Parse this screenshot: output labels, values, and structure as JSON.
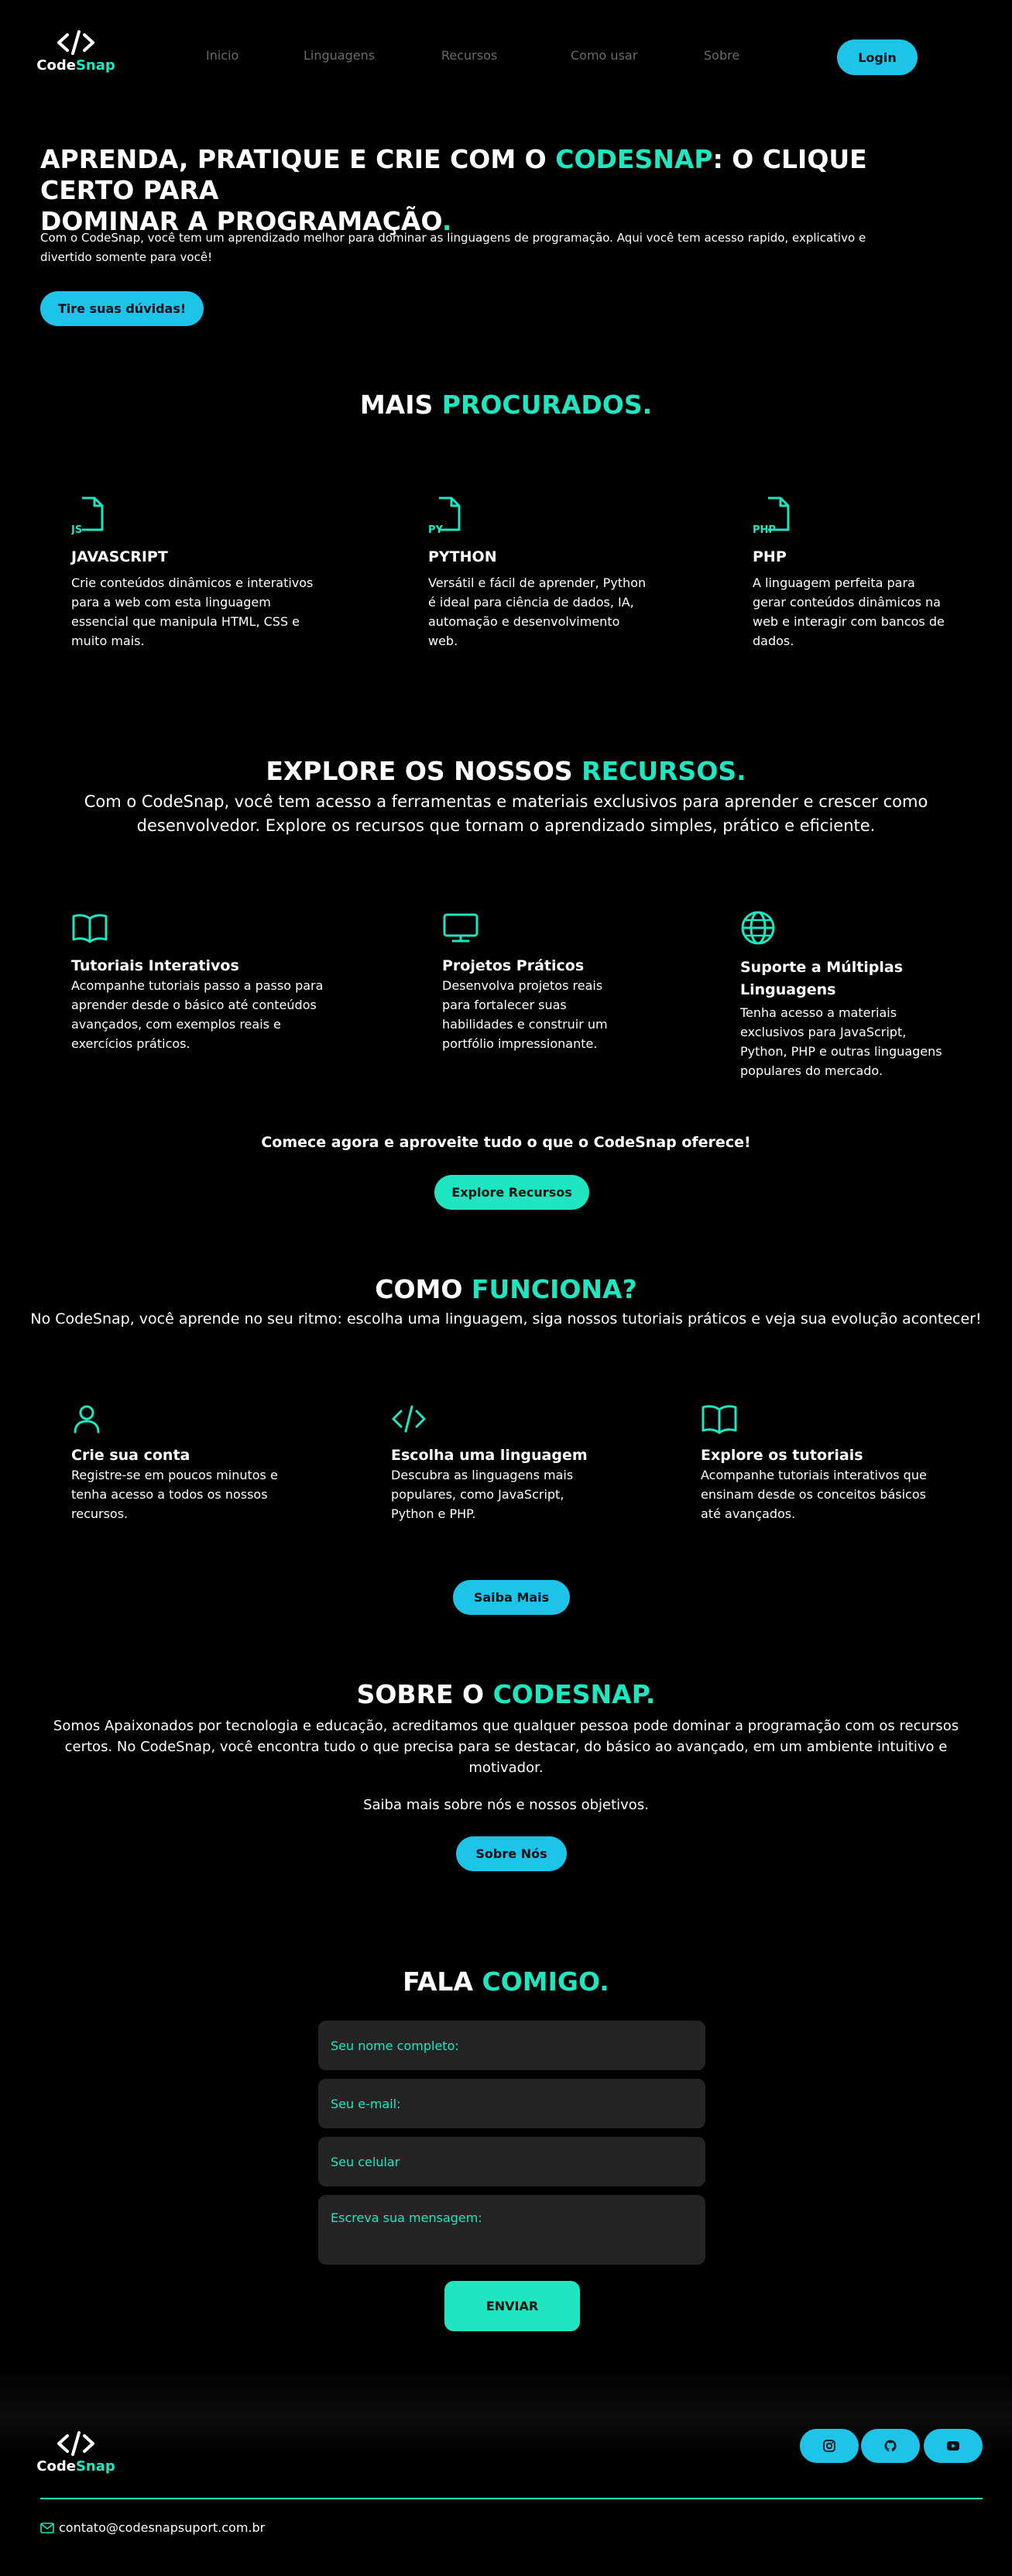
{
  "brand": {
    "logo_symbol": "</>",
    "name_part1": "Code",
    "name_part2": "Snap"
  },
  "nav": {
    "items": [
      "Inicio",
      "Linguagens",
      "Recursos",
      "Como usar",
      "Sobre"
    ],
    "login_label": "Login"
  },
  "hero": {
    "title_part1": "APRENDA, PRATIQUE E CRIE COM O ",
    "title_highlight": "CODESNAP",
    "title_part2": ": O CLIQUE CERTO PARA",
    "title_line2": "DOMINAR A PROGRAMAÇÃO",
    "title_dot": ".",
    "desc_line1": "Com o CodeSnap, você tem um aprendizado melhor para dominar as linguagens de programação. Aqui você tem acesso rapido, explicativo e",
    "desc_line2": "divertido somente para você!",
    "cta_label": "Tire suas dúvidas!"
  },
  "popular": {
    "title_part1": "MAIS ",
    "title_highlight": "PROCURADOS.",
    "cards": [
      {
        "badge": "JS",
        "title": "JAVASCRIPT",
        "lines": [
          "Crie conteúdos dinâmicos e interativos",
          "para a web com esta linguagem",
          "essencial que manipula HTML, CSS e",
          "muito mais."
        ]
      },
      {
        "badge": "PY",
        "title": "PYTHON",
        "lines": [
          "Versátil e fácil de aprender, Python",
          "é ideal para ciência de dados, IA,",
          "automação e desenvolvimento",
          "web."
        ]
      },
      {
        "badge": "PHP",
        "title": "PHP",
        "lines": [
          "A linguagem perfeita para",
          "gerar conteúdos dinâmicos na",
          "web e interagir com bancos de",
          "dados."
        ]
      }
    ]
  },
  "resources": {
    "title_part1": "EXPLORE OS NOSSOS ",
    "title_highlight": "RECURSOS.",
    "sub_line1": "Com o CodeSnap, você tem acesso a ferramentas e materiais exclusivos para aprender e crescer como",
    "sub_line2": "desenvolvedor. Explore os recursos que tornam o aprendizado simples, prático e eficiente.",
    "cards": [
      {
        "icon": "book-icon",
        "title_lines": [
          "Tutoriais Interativos"
        ],
        "lines": [
          "Acompanhe tutoriais passo a passo para",
          "aprender desde o básico até conteúdos",
          "avançados, com exemplos reais e",
          "exercícios práticos."
        ]
      },
      {
        "icon": "monitor-icon",
        "title_lines": [
          "Projetos Práticos"
        ],
        "lines": [
          "Desenvolva projetos reais",
          "para fortalecer suas",
          "habilidades e construir um",
          "portfólio impressionante."
        ]
      },
      {
        "icon": "globe-icon",
        "title_lines": [
          "Suporte a Múltiplas",
          "Linguagens"
        ],
        "lines": [
          "Tenha acesso a materiais",
          "exclusivos para JavaScript,",
          "Python, PHP e outras linguagens",
          "populares do mercado."
        ]
      }
    ],
    "cta_text": "Comece agora e aproveite tudo o que o CodeSnap oferece!",
    "cta_label": "Explore Recursos"
  },
  "how": {
    "title_part1": "COMO ",
    "title_highlight": "FUNCIONA?",
    "sub": "No CodeSnap, você aprende no seu ritmo: escolha uma linguagem, siga nossos tutoriais práticos e veja sua evolução acontecer!",
    "cards": [
      {
        "icon": "user-icon",
        "title": "Crie sua conta",
        "lines": [
          "Registre-se em poucos minutos e",
          "tenha acesso a todos os nossos",
          "recursos."
        ]
      },
      {
        "icon": "code-icon",
        "title": "Escolha uma linguagem",
        "lines": [
          "Descubra as linguagens mais",
          "populares, como JavaScript,",
          "Python e PHP."
        ]
      },
      {
        "icon": "book-icon",
        "title": "Explore os tutoriais",
        "lines": [
          "Acompanhe tutoriais interativos que",
          "ensinam desde os conceitos básicos",
          "até avançados."
        ]
      }
    ],
    "cta_label": "Saiba Mais"
  },
  "about": {
    "title_part1": "SOBRE O ",
    "title_highlight": "CODESNAP.",
    "lines": [
      "Somos Apaixonados por tecnologia e educação, acreditamos que qualquer pessoa pode dominar a programação com os recursos",
      "certos. No CodeSnap, você encontra tudo o que precisa para se destacar, do básico ao avançado, em um ambiente intuitivo e",
      "motivador."
    ],
    "more": "Saiba mais sobre nós e nossos objetivos.",
    "cta_label": "Sobre Nós"
  },
  "contact": {
    "title_part1": "FALA ",
    "title_highlight": "COMIGO.",
    "name_placeholder": "Seu nome completo:",
    "email_placeholder": "Seu e-mail:",
    "phone_placeholder": "Seu celular",
    "message_placeholder": "Escreva sua mensagem:",
    "submit_label": "ENVIAR"
  },
  "footer": {
    "email": "contato@codesnapsuport.com.br",
    "social": [
      "instagram-icon",
      "github-icon",
      "youtube-icon"
    ]
  },
  "colors": {
    "accent": "#1fe6c0",
    "button": "#1ec3e8",
    "field": "#242424",
    "background": "#000000"
  }
}
